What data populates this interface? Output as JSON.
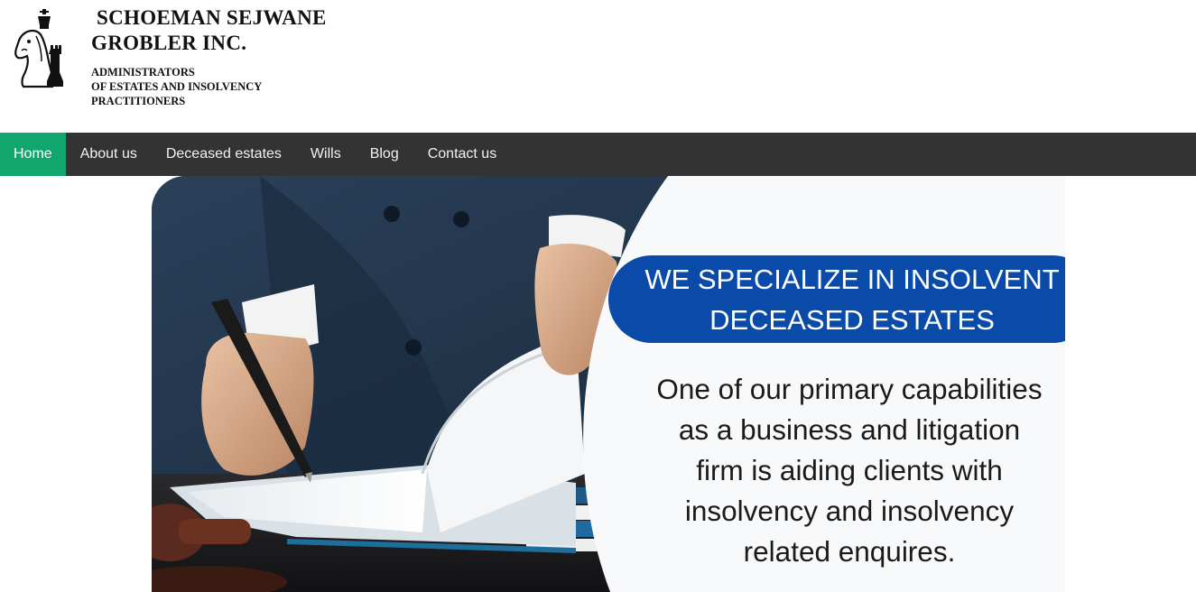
{
  "brand": {
    "name_line1": "SCHOEMAN SEJWANE",
    "name_line2": "GROBLER INC.",
    "tagline_line1": "ADMINISTRATORS",
    "tagline_line2": "OF ESTATES AND INSOLVENCY",
    "tagline_line3": "PRACTITIONERS",
    "logo_icon": "chess-knight-logo"
  },
  "nav": {
    "items": [
      {
        "label": "Home",
        "active": true
      },
      {
        "label": "About us",
        "active": false
      },
      {
        "label": "Deceased estates",
        "active": false
      },
      {
        "label": "Wills",
        "active": false
      },
      {
        "label": "Blog",
        "active": false
      },
      {
        "label": "Contact us",
        "active": false
      }
    ]
  },
  "hero": {
    "headline_line1": "WE SPECIALIZE IN INSOLVENT",
    "headline_line2": "DECEASED ESTATES",
    "body": "One of our primary capabilities as a business and litigation firm is aiding clients with insolvency and insolvency related enquires."
  },
  "colors": {
    "nav_bg": "#333333",
    "nav_active": "#10a66e",
    "banner_blue": "#0a4aa8",
    "hero_dark": "#203449"
  }
}
